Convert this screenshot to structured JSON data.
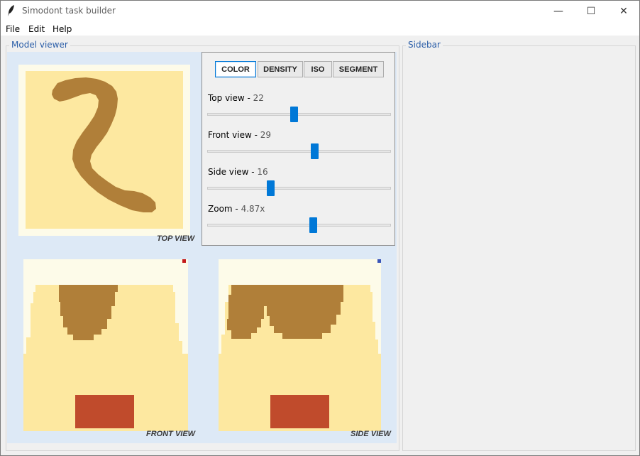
{
  "window": {
    "title": "Simodont task builder",
    "minimize_glyph": "—",
    "maximize_glyph": "☐",
    "close_glyph": "✕"
  },
  "menu": {
    "items": [
      "File",
      "Edit",
      "Help"
    ]
  },
  "model_viewer": {
    "label": "Model viewer",
    "views": {
      "top": "TOP VIEW",
      "front": "FRONT VIEW",
      "side": "SIDE VIEW"
    },
    "marker_colors": {
      "front": "#c41a1a",
      "side": "#3a55b8"
    }
  },
  "controls": {
    "modes": [
      "COLOR",
      "DENSITY",
      "ISO",
      "SEGMENT"
    ],
    "active_mode": "COLOR",
    "sliders": [
      {
        "label": "Top view -",
        "value": "22",
        "position_fraction": 0.47
      },
      {
        "label": "Front view -",
        "value": "29",
        "position_fraction": 0.59
      },
      {
        "label": "Side view -",
        "value": "16",
        "position_fraction": 0.34
      },
      {
        "label": "Zoom -",
        "value": "4.87x",
        "position_fraction": 0.58
      }
    ]
  },
  "sidebar": {
    "label": "Sidebar"
  },
  "colors": {
    "tissue_light": "#fde8a0",
    "tissue_dark": "#b07f39",
    "lesion": "#c04b2c",
    "viewer_background": "#dde9f6",
    "accent": "#0078d7"
  }
}
